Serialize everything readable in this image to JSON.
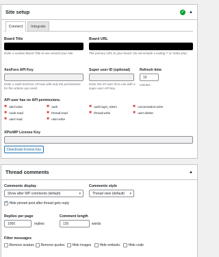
{
  "site_setup": {
    "title": "Site setup",
    "tabs": [
      "Connect",
      "Integrate"
    ],
    "board_title": {
      "label": "Board Title",
      "value": "",
      "help": "Enter a custom Board Title to use around your site."
    },
    "board_url": {
      "label": "Board URL",
      "value": "",
      "help": "The primary URL to your board. Do not include a trailing '/' or 'index.php'."
    },
    "api_key": {
      "label": "XenForo API Key",
      "value": "",
      "help": "Enter a valid XenForo API key with only the permissions for the actions you need."
    },
    "super_user": {
      "label": "Super user ID (optional)",
      "value": "",
      "help": "Enter the XF user ID to use with a super user API key."
    },
    "refresh": {
      "label": "Refresh time",
      "value": "10",
      "help": "minutes"
    },
    "no_permissions": "API user has no API permissions.",
    "permissions": [
      [
        "alert:write",
        "auth",
        "auth:login_token",
        "conversation:write"
      ],
      [
        "node:read",
        "thread:read",
        "thread:write",
        "user:delete"
      ],
      [
        "user:read",
        "user:write"
      ]
    ],
    "license": {
      "label": "XPtoWP License Key",
      "value": ""
    },
    "deactivate_label": "Deactivate license key"
  },
  "thread_comments": {
    "title": "Thread comments",
    "comments_display": {
      "label": "Comments display",
      "value": "Show after WP comments (default)"
    },
    "comments_style": {
      "label": "Comments style",
      "value": "Thread view (default)"
    },
    "hide_pinned": "Hide pinned post after thread gets reply",
    "replies_per_page": {
      "label": "Replies per page",
      "value": "1000",
      "suffix": "replies"
    },
    "comment_length": {
      "label": "Comment length",
      "value": "120",
      "suffix": "words"
    },
    "filter_label": "Filter messages",
    "filters": [
      "Remove avatars",
      "Remove quotes",
      "Hide images",
      "Hide embeds",
      "Hide code"
    ]
  }
}
